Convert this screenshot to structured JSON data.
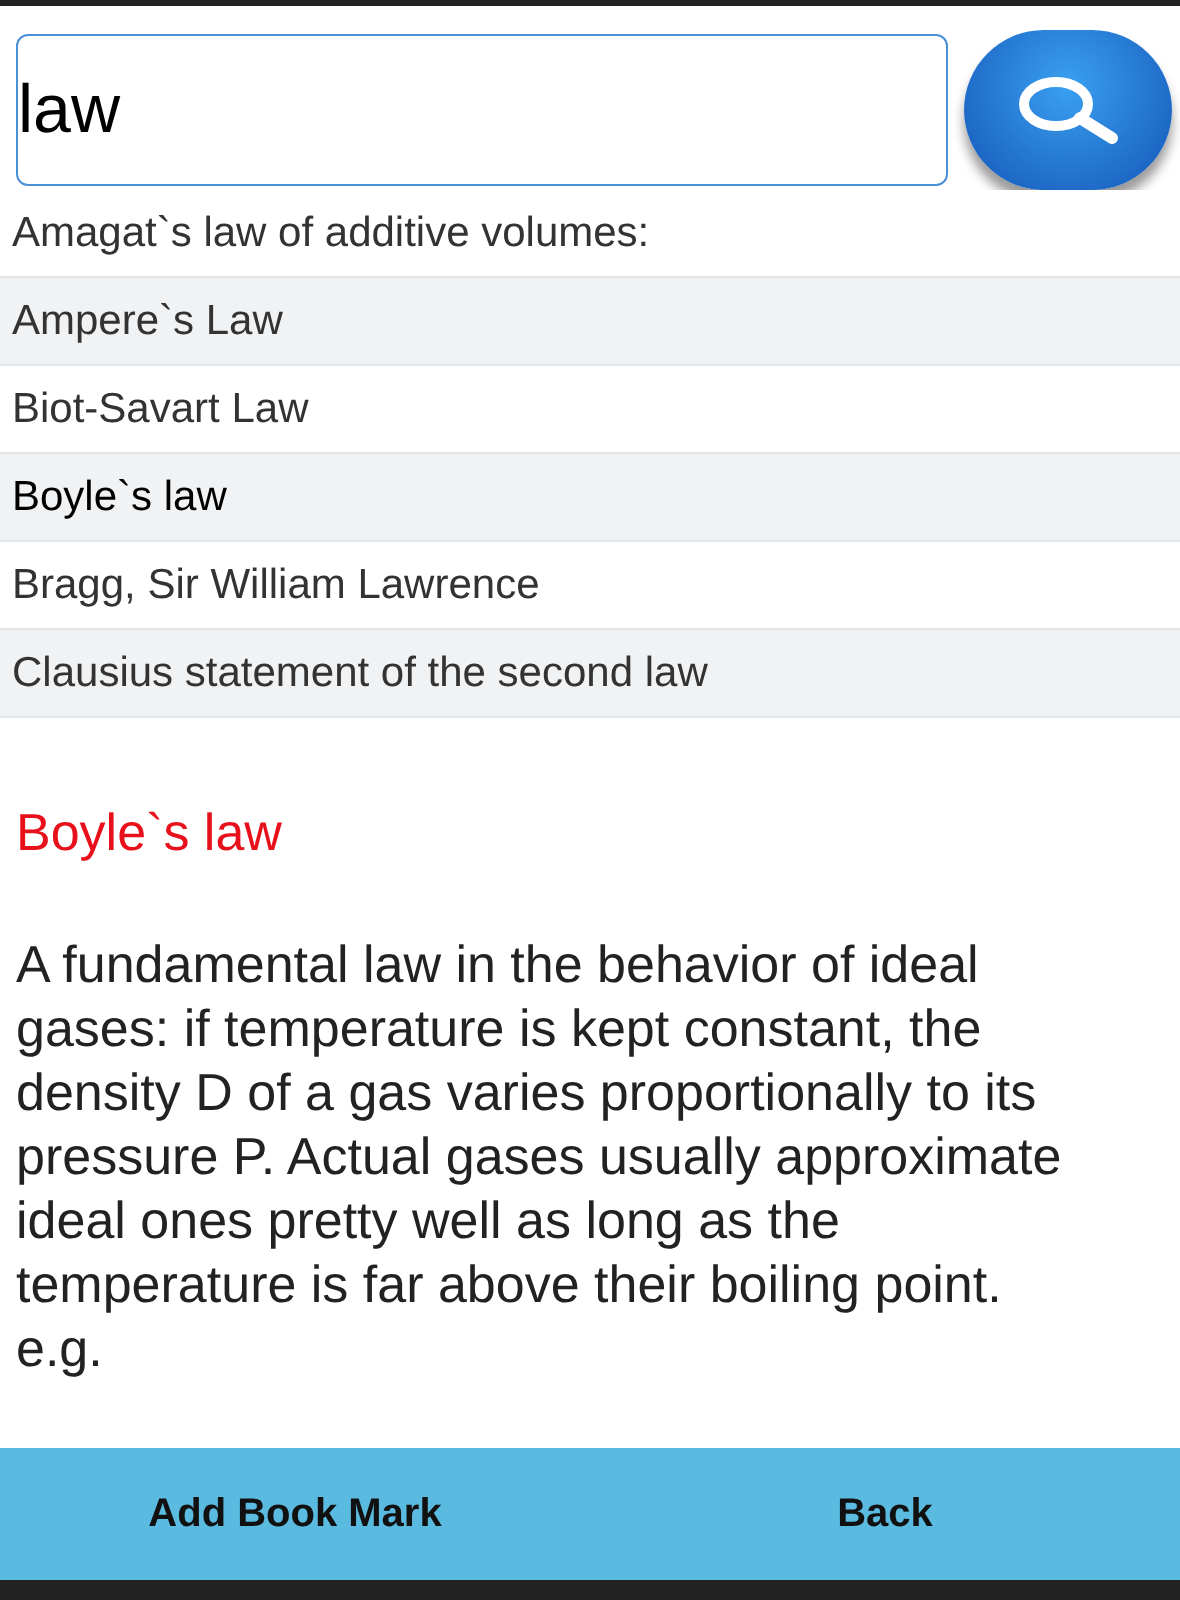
{
  "search": {
    "value": "law"
  },
  "results": [
    {
      "label": "Amagat`s law of additive volumes:",
      "selected": false
    },
    {
      "label": "Ampere`s Law",
      "selected": false
    },
    {
      "label": "Biot-Savart Law",
      "selected": false
    },
    {
      "label": "Boyle`s law",
      "selected": true
    },
    {
      "label": "Bragg, Sir William Lawrence",
      "selected": false
    },
    {
      "label": "Clausius statement of the second law",
      "selected": false
    }
  ],
  "definition": {
    "title": "Boyle`s law",
    "text": "A fundamental law in the behavior of ideal gases: if temperature is kept constant, the density D of a gas varies proportionally to its pressure P. Actual gases usually approximate ideal ones pretty well as long as the temperature is far above their boiling point. e.g."
  },
  "buttons": [
    "Add Book Mark",
    "Back"
  ]
}
